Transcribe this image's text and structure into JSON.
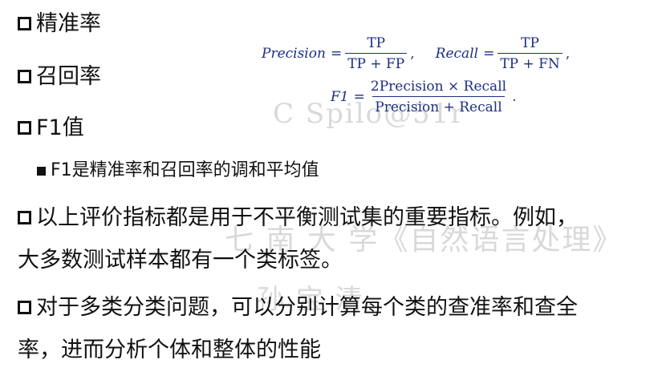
{
  "bullets": {
    "precision": "精准率",
    "recall": "召回率",
    "f1": "F1值",
    "f1_sub": "F1是精准率和召回率的调和平均值",
    "point1": {
      "line1": "以上评价指标都是用于不平衡测试集的重要指标。例如，",
      "line2": "大多数测试样本都有一个类标签。"
    },
    "point2": {
      "line1": "对于多类分类问题，可以分别计算每个类的查准率和查全",
      "line2": "率，进而分析个体和整体的性能"
    }
  },
  "formulas": {
    "precision_lhs": "Precision",
    "recall_lhs": "Recall",
    "f1_lhs": "F1",
    "equals": "=",
    "comma": ",",
    "period": ".",
    "precision_num": "TP",
    "precision_den": "TP + FP",
    "recall_num": "TP",
    "recall_den": "TP + FN",
    "f1_num": "2Precision × Recall",
    "f1_den": "Precision + Recall"
  },
  "watermarks": {
    "w1": "C  Spilo@51r",
    "w2": "七 南 大 学《自然语言处理》",
    "w3": "孙 宝 清"
  }
}
